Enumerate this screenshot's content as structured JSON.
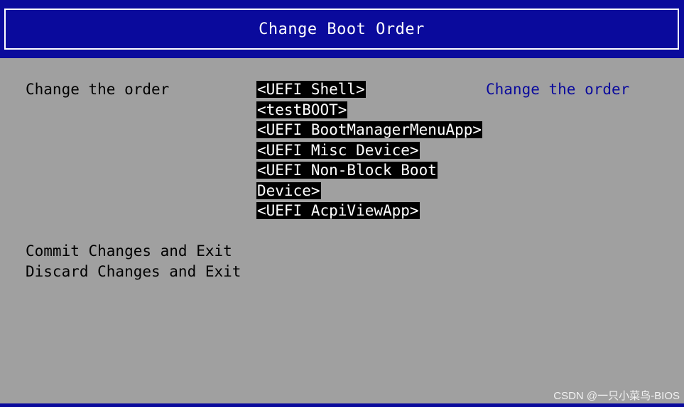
{
  "header": {
    "title": "Change Boot Order"
  },
  "main": {
    "prompt_label": "Change the order",
    "boot_order": [
      {
        "lines": [
          "<UEFI Shell>"
        ]
      },
      {
        "lines": [
          "<testBOOT>"
        ]
      },
      {
        "lines": [
          "<UEFI BootManagerMenuApp>"
        ]
      },
      {
        "lines": [
          "<UEFI Misc Device>"
        ]
      },
      {
        "lines": [
          "<UEFI Non-Block Boot",
          "Device>"
        ]
      },
      {
        "lines": [
          "<UEFI AcpiViewApp>"
        ]
      }
    ],
    "commit_label": "Commit Changes and Exit",
    "discard_label": "Discard Changes and Exit"
  },
  "help": {
    "text": "Change the order"
  },
  "watermark": "CSDN @一只小菜鸟-BIOS",
  "colors": {
    "background": "#a0a0a0",
    "title_bar": "#0a0a9c",
    "highlight_bg": "#000000",
    "highlight_fg": "#ffffff",
    "help_text": "#0a0a9c"
  }
}
